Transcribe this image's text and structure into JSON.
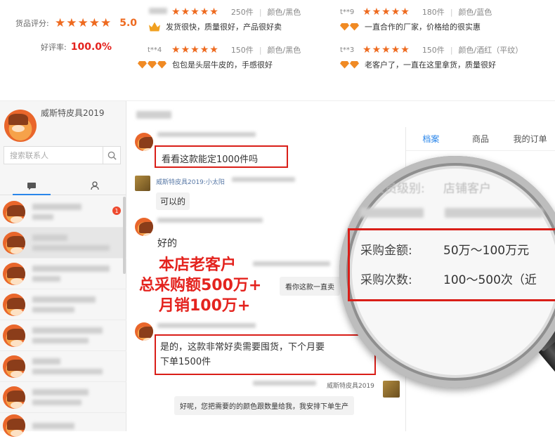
{
  "rating": {
    "goods_label": "货品评分:",
    "score": "5.0",
    "good_rate_label": "好评率:",
    "good_rate": "100.0%"
  },
  "reviews": [
    {
      "user": "",
      "qty": "250件",
      "color": "颜色/黑色",
      "text": "发货很快，质量很好，产品很好卖",
      "badge": "crown"
    },
    {
      "user": "t**9",
      "qty": "180件",
      "color": "颜色/蓝色",
      "text": "一直合作的厂家，价格给的很实惠",
      "badge": "diamond2"
    },
    {
      "user": "t**4",
      "qty": "150件",
      "color": "颜色/黑色",
      "text": "包包是头层牛皮的，手感很好",
      "badge": "diamond3"
    },
    {
      "user": "t**3",
      "qty": "150件",
      "color": "颜色/酒红（平纹）",
      "text": "老客户了，一直在这里拿货，质量很好",
      "badge": "diamond2"
    }
  ],
  "chat": {
    "shop_name": "威斯特皮具2019",
    "search_placeholder": "搜索联系人",
    "unread_count": "1",
    "messages": {
      "m1_text": "看看这款能定1000件吗",
      "m2_sender": "威斯特皮具2019:小太阳",
      "m2_text": "可以的",
      "m3_text": "好的",
      "m4_text": "看你这款一直卖",
      "m5_text": "是的，这款非常好卖需要囤货，下个月要",
      "m5_text2": "下单1500件",
      "m6_sender": "威斯特皮具2019",
      "m6_text": "好呢，您把需要的的颜色跟数量给我，我安排下单生产"
    },
    "info_tabs": [
      "档案",
      "商品",
      "我的订单"
    ]
  },
  "magnifier": {
    "row0_label": "会员级别:",
    "row0_value": "店铺客户",
    "amount_label": "采购金额:",
    "amount_value": "50万～100万元",
    "count_label": "采购次数:",
    "count_value": "100～500次（近"
  },
  "annotation": {
    "line1": "本店老客户",
    "line2": "总采购额500万+",
    "line3": "月销100万+"
  },
  "colors": {
    "accent": "#2a86ea",
    "star": "#ee6a1f",
    "highlight": "#e4231e"
  }
}
